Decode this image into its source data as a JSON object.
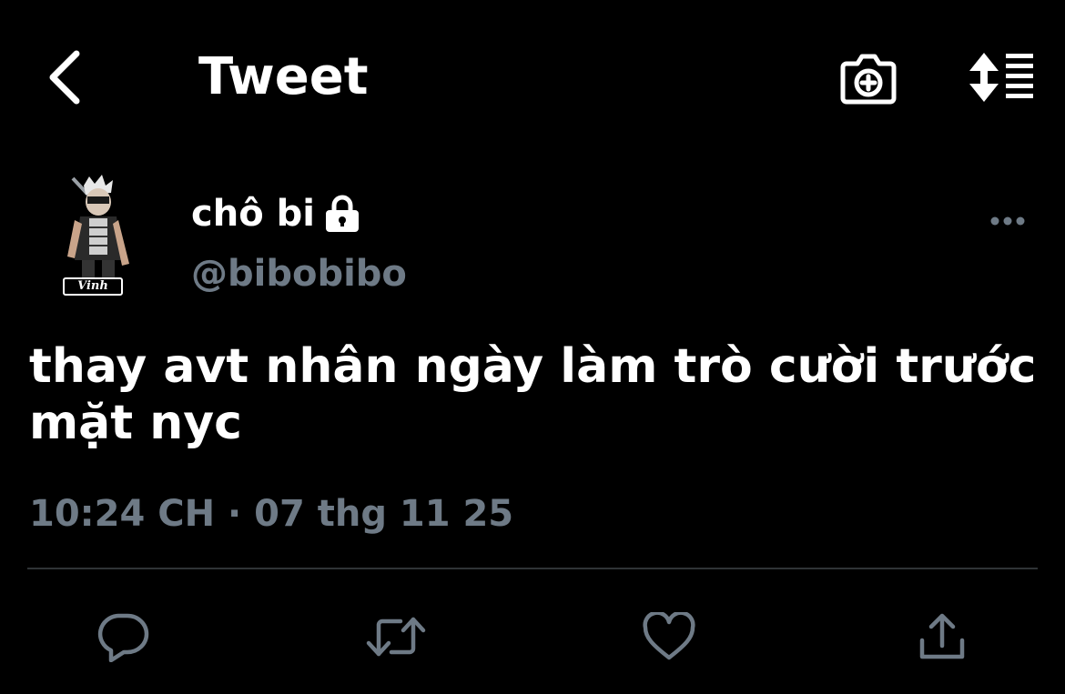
{
  "header": {
    "title": "Tweet",
    "back_icon": "chevron-left-icon",
    "camera_icon": "camera-plus-icon",
    "sort_icon": "sort-lines-icon"
  },
  "author": {
    "display_name": "chô bi",
    "handle": "@bibobibo",
    "protected": true,
    "avatar_badge": "Vinh",
    "more_icon": "more-horizontal-icon"
  },
  "tweet": {
    "text": "thay avt nhân ngày làm trò cười trước\nmặt nyc",
    "timestamp": "10:24 CH · 07 thg 11 25"
  },
  "actions": [
    {
      "name": "reply",
      "icon": "reply-icon"
    },
    {
      "name": "retweet",
      "icon": "retweet-icon"
    },
    {
      "name": "like",
      "icon": "heart-icon"
    },
    {
      "name": "share",
      "icon": "share-icon"
    }
  ],
  "colors": {
    "background": "#000000",
    "text": "#ffffff",
    "secondary": "#6e7a86",
    "divider": "#2f3336"
  }
}
